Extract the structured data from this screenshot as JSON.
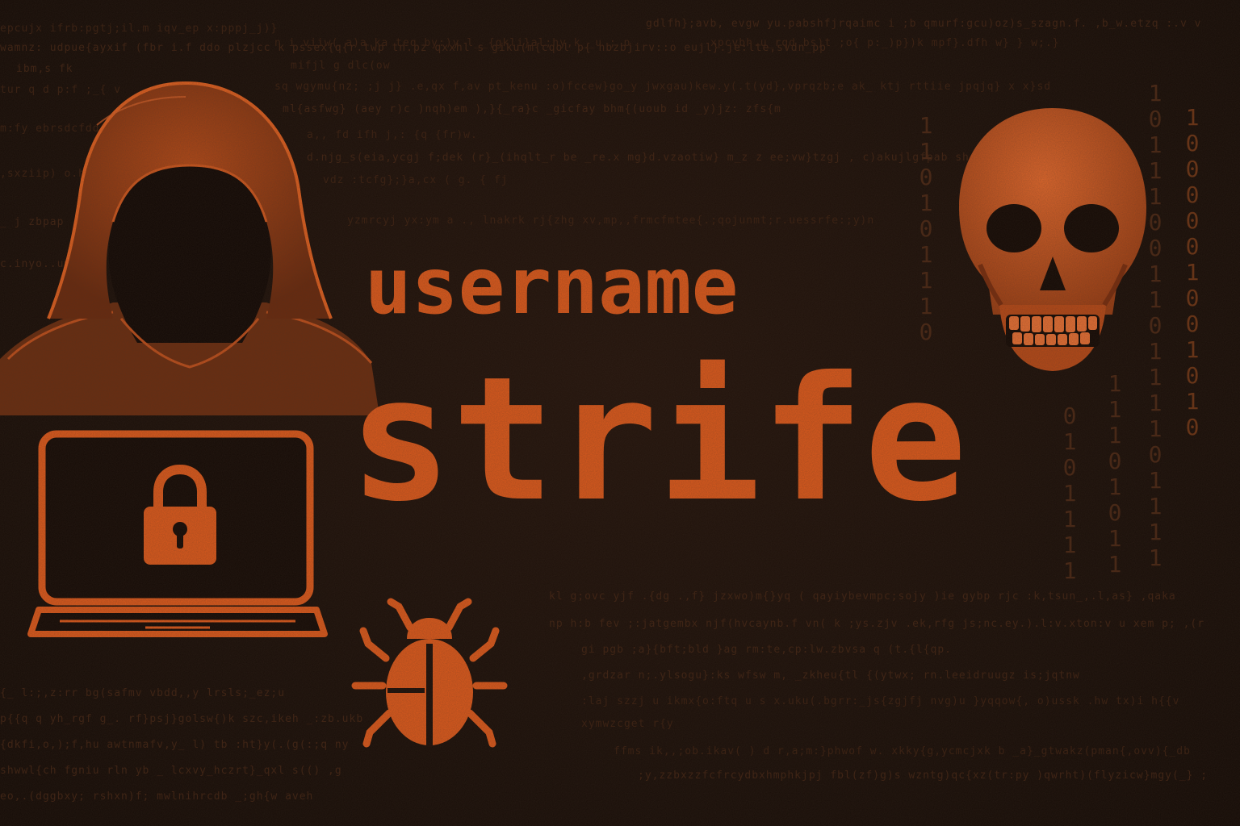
{
  "title": {
    "line1": "username",
    "line2": "strife"
  },
  "binary_columns": [
    "110101110",
    "1011100110",
    "111101111",
    "1000001001010",
    "0101111",
    "11101011"
  ],
  "icons": {
    "hacker": "hooded-hacker-icon",
    "laptop": "laptop-icon",
    "lock": "padlock-icon",
    "bug": "bug-icon",
    "skull": "skull-icon"
  },
  "colors": {
    "accent": "#de5a1c",
    "background": "#1c100a",
    "code_text": "#3f2212"
  }
}
